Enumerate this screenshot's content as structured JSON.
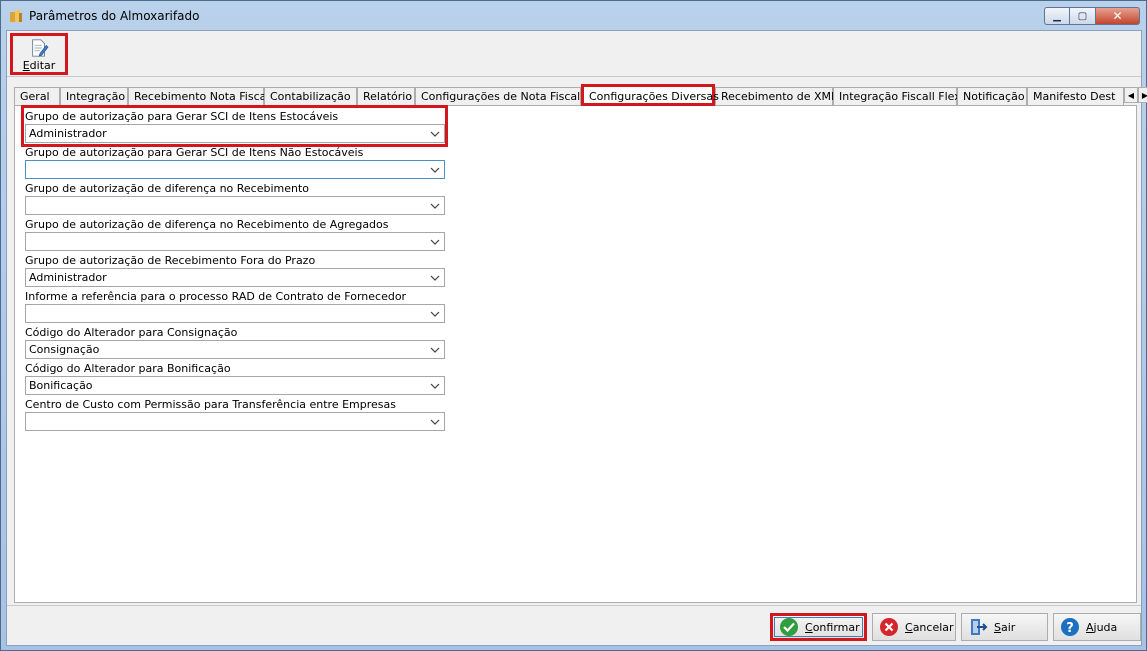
{
  "window": {
    "title": "Parâmetros do Almoxarifado"
  },
  "toolbar": {
    "edit_label": "Editar"
  },
  "tabs": [
    {
      "label": "Geral"
    },
    {
      "label": "Integração"
    },
    {
      "label": "Recebimento Nota Fiscal"
    },
    {
      "label": "Contabilização"
    },
    {
      "label": "Relatório"
    },
    {
      "label": "Configurações de Nota Fiscal"
    },
    {
      "label": "Configurações Diversas",
      "active": true
    },
    {
      "label": "Recebimento de XML"
    },
    {
      "label": "Integração Fiscall Flex"
    },
    {
      "label": "Notificação"
    },
    {
      "label": "Manifesto Dest"
    }
  ],
  "fields": [
    {
      "label": "Grupo de autorização para Gerar SCI de Itens Estocáveis",
      "value": "Administrador"
    },
    {
      "label": "Grupo de autorização para Gerar SCI de Itens Não Estocáveis",
      "value": ""
    },
    {
      "label": "Grupo de autorização de diferença no Recebimento",
      "value": ""
    },
    {
      "label": "Grupo de autorização de diferença no Recebimento de Agregados",
      "value": ""
    },
    {
      "label": "Grupo de autorização de Recebimento Fora do Prazo",
      "value": "Administrador"
    },
    {
      "label": "Informe a referência para o processo RAD de Contrato de Fornecedor",
      "value": ""
    },
    {
      "label": "Código do Alterador para Consignação",
      "value": "Consignação"
    },
    {
      "label": "Código do Alterador para Bonificação",
      "value": "Bonificação"
    },
    {
      "label": "Centro de Custo com Permissão para Transferência entre Empresas",
      "value": ""
    }
  ],
  "buttons": {
    "confirm": "Confirmar",
    "cancel": "Cancelar",
    "exit": "Sair",
    "help": "Ajuda"
  },
  "colors": {
    "highlight": "#d4171c",
    "confirm_icon": "#2e9e3e",
    "cancel_icon": "#d6262c",
    "help_icon": "#1d6fc0"
  }
}
